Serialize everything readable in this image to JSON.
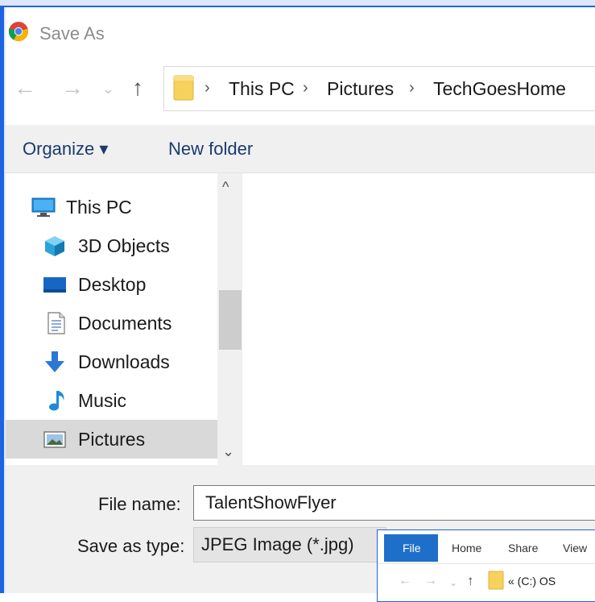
{
  "window": {
    "title": "Save As"
  },
  "nav": {
    "back": "←",
    "forward": "→",
    "recent": "⌄",
    "up": "↑"
  },
  "address": {
    "sep": "›",
    "crumbs": [
      "This PC",
      "Pictures",
      "TechGoesHome"
    ]
  },
  "toolbar": {
    "organize": "Organize ▾",
    "new_folder": "New folder"
  },
  "navpane": {
    "items": [
      {
        "label": "This PC",
        "icon": "computer-icon"
      },
      {
        "label": "3D Objects",
        "icon": "cube-icon"
      },
      {
        "label": "Desktop",
        "icon": "desktop-icon"
      },
      {
        "label": "Documents",
        "icon": "document-icon"
      },
      {
        "label": "Downloads",
        "icon": "download-arrow-icon"
      },
      {
        "label": "Music",
        "icon": "music-note-icon"
      },
      {
        "label": "Pictures",
        "icon": "picture-icon",
        "selected": true
      }
    ]
  },
  "scroll": {
    "up": "^",
    "down": "⌄"
  },
  "form": {
    "file_name_label": "File name:",
    "file_name_value": "TalentShowFlyer",
    "save_type_label": "Save as type:",
    "save_type_value": "JPEG Image (*.jpg)"
  },
  "explorer": {
    "tabs": [
      "File",
      "Home",
      "Share",
      "View"
    ],
    "path": "« (C:) OS",
    "back": "←",
    "forward": "→",
    "recent": "⌄",
    "up": "↑"
  },
  "colors": {
    "accent": "#1f63e0",
    "folder": "#f6d15b",
    "selected": "#d9d9d9"
  }
}
